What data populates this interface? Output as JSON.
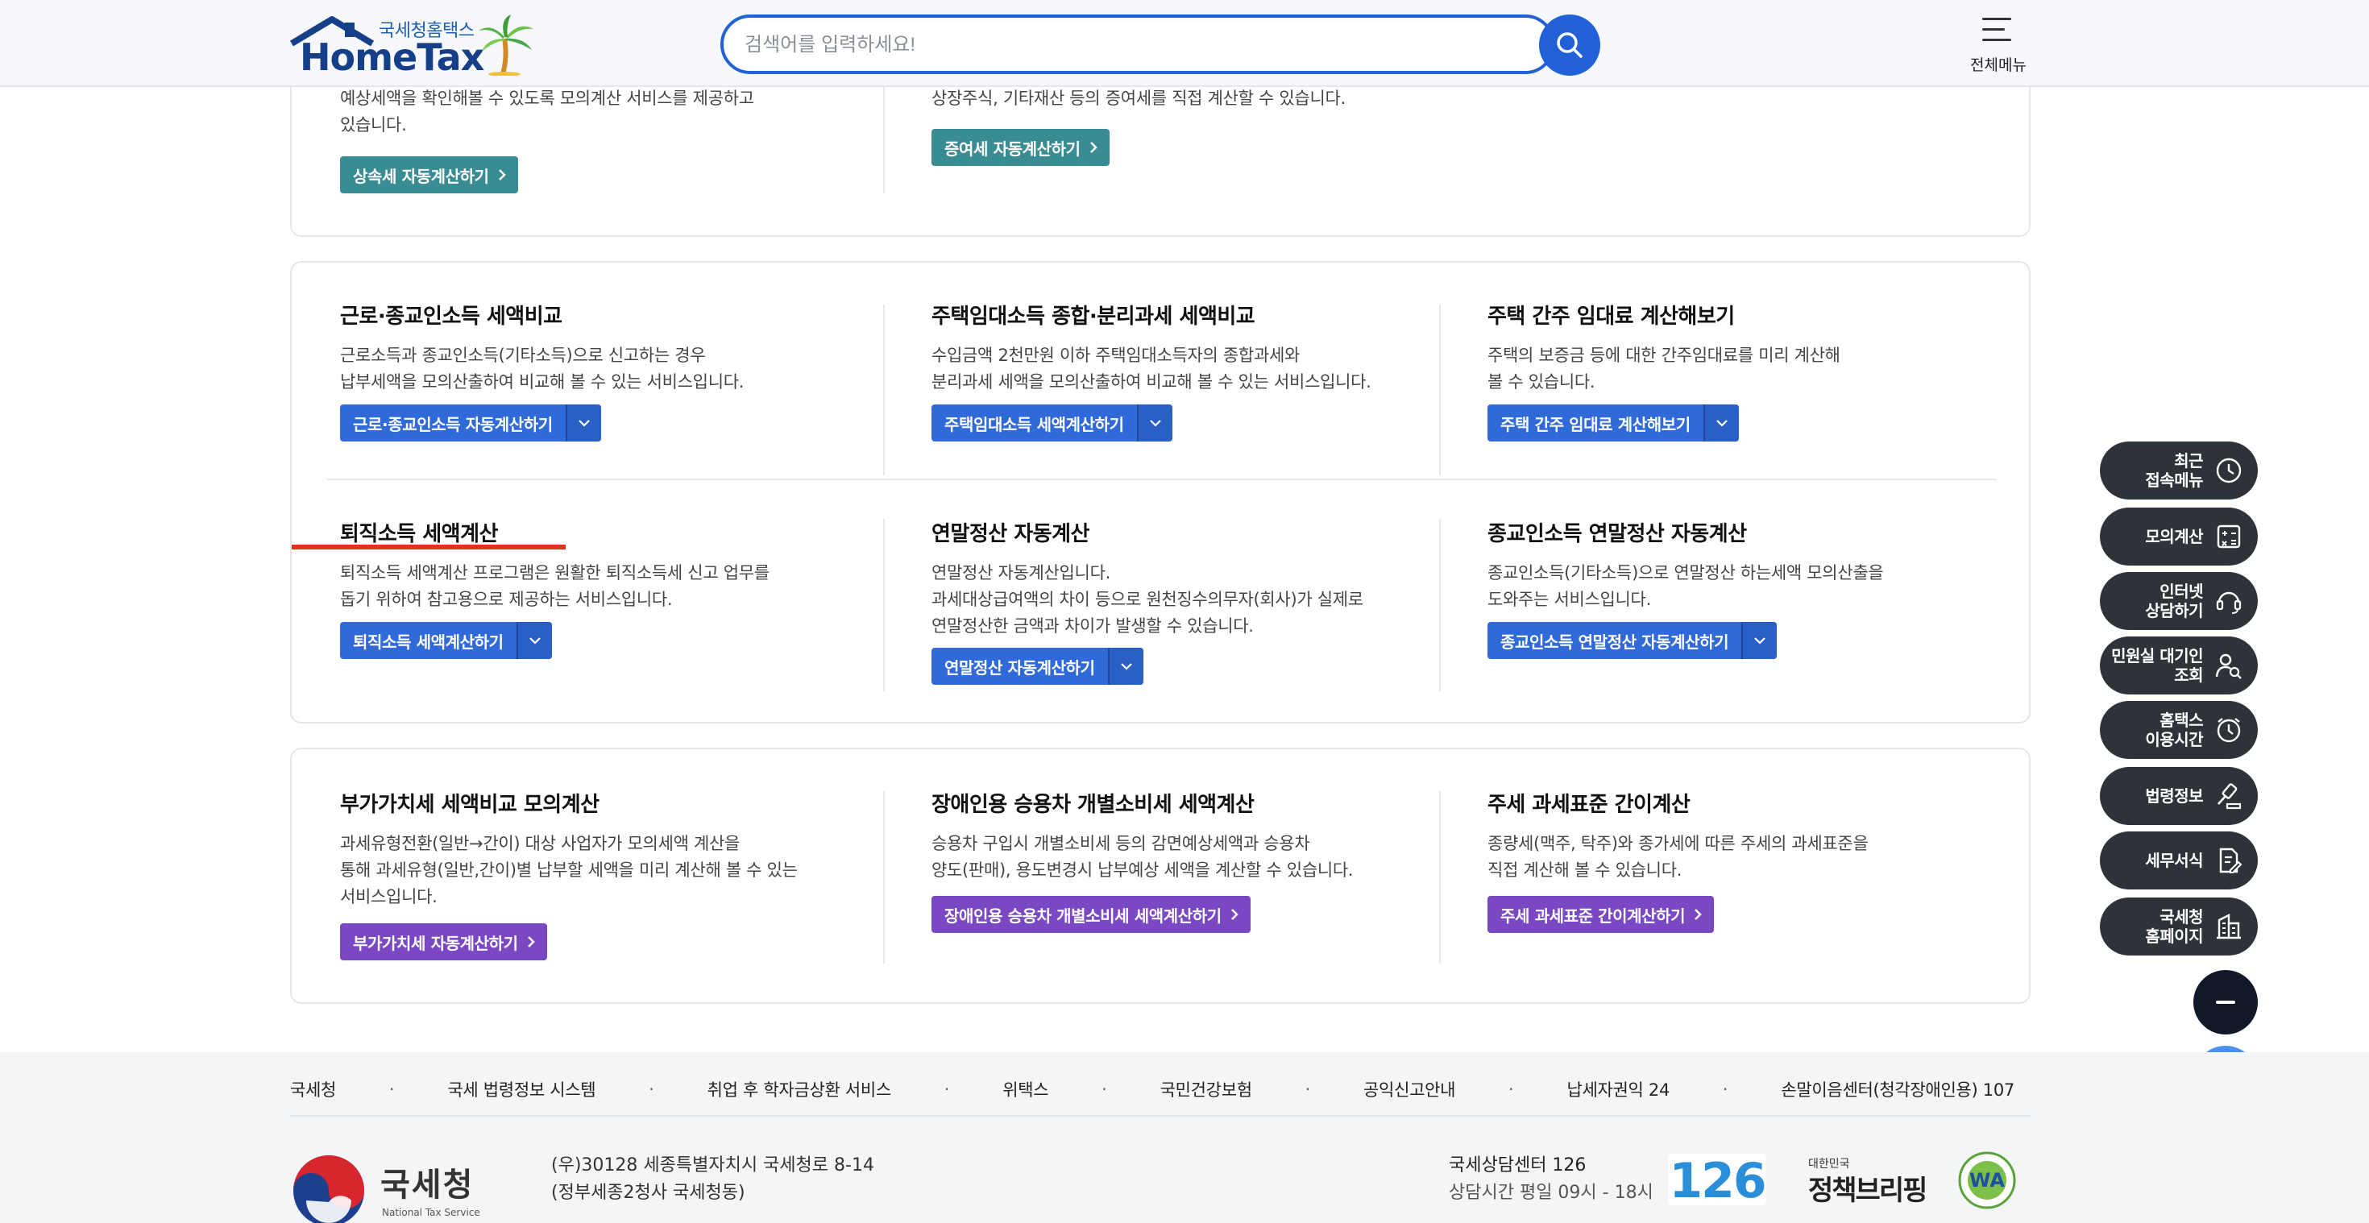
{
  "header": {
    "brand_small": "국세청홈택스",
    "brand_big": "HomeTax",
    "search_placeholder": "검색어를 입력하세요!",
    "all_menu_label": "전체메뉴"
  },
  "section_inheritance": {
    "left_desc": "예상세액을 확인해볼 수 있도록 모의계산 서비스를 제공하고\n있습니다.",
    "left_button": "상속세 자동계산하기",
    "right_desc": "상장주식, 기타재산 등의 증여세를 직접 계산할 수 있습니다.",
    "right_button": "증여세 자동계산하기"
  },
  "section_income": {
    "items": [
      {
        "title": "근로·종교인소득 세액비교",
        "desc": "근로소득과 종교인소득(기타소득)으로 신고하는 경우\n납부세액을 모의산출하여 비교해 볼 수 있는 서비스입니다.",
        "button": "근로·종교인소득 자동계산하기"
      },
      {
        "title": "주택임대소득 종합·분리과세 세액비교",
        "desc": "수입금액 2천만원 이하 주택임대소득자의 종합과세와\n분리과세 세액을 모의산출하여 비교해 볼 수 있는 서비스입니다.",
        "button": "주택임대소득 세액계산하기"
      },
      {
        "title": "주택 간주 임대료 계산해보기",
        "desc": "주택의 보증금 등에 대한 간주임대료를 미리 계산해\n볼 수 있습니다.",
        "button": "주택 간주 임대료 계산해보기"
      },
      {
        "title": "퇴직소득 세액계산",
        "desc": "퇴직소득 세액계산 프로그램은 원활한 퇴직소득세 신고 업무를\n돕기 위하여 참고용으로 제공하는 서비스입니다.",
        "button": "퇴직소득 세액계산하기"
      },
      {
        "title": "연말정산 자동계산",
        "desc": "연말정산 자동계산입니다.\n과세대상급여액의 차이 등으로 원천징수의무자(회사)가 실제로\n연말정산한 금액과 차이가 발생할 수 있습니다.",
        "button": "연말정산 자동계산하기"
      },
      {
        "title": "종교인소득 연말정산 자동계산",
        "desc": "종교인소득(기타소득)으로 연말정산 하는세액 모의산출을\n도와주는 서비스입니다.",
        "button": "종교인소득 연말정산 자동계산하기"
      }
    ]
  },
  "section_vat": {
    "items": [
      {
        "title": "부가가치세 세액비교 모의계산",
        "desc": "과세유형전환(일반→간이) 대상 사업자가 모의세액 계산을\n통해 과세유형(일반,간이)별 납부할 세액을 미리 계산해 볼 수 있는\n서비스입니다.",
        "button": "부가가치세 자동계산하기"
      },
      {
        "title": "장애인용 승용차 개별소비세 세액계산",
        "desc": "승용차 구입시 개별소비세 등의 감면예상세액과 승용차\n양도(판매), 용도변경시 납부예상 세액을 계산할 수 있습니다.",
        "button": "장애인용 승용차 개별소비세 세액계산하기"
      },
      {
        "title": "주세 과세표준 간이계산",
        "desc": "종량세(맥주, 탁주)와 종가세에 따른 주세의 과세표준을\n직접 계산해 볼 수 있습니다.",
        "button": "주세 과세표준 간이계산하기"
      }
    ]
  },
  "side_menu": [
    {
      "label": "최근\n접속메뉴",
      "icon": "clock-icon"
    },
    {
      "label": "모의계산",
      "icon": "calculator-icon"
    },
    {
      "label": "인터넷\n상담하기",
      "icon": "chat-icon"
    },
    {
      "label": "민원실 대기인\n조회",
      "icon": "person-search-icon"
    },
    {
      "label": "홈택스\n이용시간",
      "icon": "clock-icon"
    },
    {
      "label": "법령정보",
      "icon": "gavel-icon"
    },
    {
      "label": "세무서식",
      "icon": "document-edit-icon"
    },
    {
      "label": "국세청\n홈페이지",
      "icon": "building-icon"
    }
  ],
  "footer": {
    "links": [
      "국세청",
      "국세 법령정보 시스템",
      "취업 후 학자금상환 서비스",
      "위택스",
      "국민건강보험",
      "공익신고안내",
      "납세자권익 24",
      "손말이음센터(청각장애인용) 107"
    ],
    "logo_kr": "국세청",
    "logo_en": "National Tax Service",
    "address": "(우)30128 세종특별자치시 국세청로 8-14\n(정부세종2청사 국세청동)",
    "center_title": "국세상담센터 126",
    "center_hours": "상담시간 평일 09시 - 18시",
    "badge_126": "126",
    "policy_small": "대한민국",
    "policy_big": "정책브리핑",
    "wa_label": "WA"
  },
  "colors": {
    "primary_blue": "#2160d6",
    "teal_button": "#3a8c93",
    "blue_button": "#2f6ad8",
    "purple_button": "#7b48c4",
    "side_menu_bg": "#2e3239",
    "highlight_red": "#e0321f"
  }
}
